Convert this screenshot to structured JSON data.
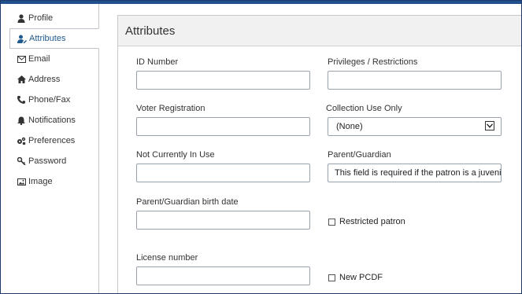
{
  "sidebar": {
    "items": [
      {
        "label": "Profile",
        "icon": "user-icon"
      },
      {
        "label": "Attributes",
        "icon": "user-edit-icon"
      },
      {
        "label": "Email",
        "icon": "envelope-icon"
      },
      {
        "label": "Address",
        "icon": "home-icon"
      },
      {
        "label": "Phone/Fax",
        "icon": "phone-icon"
      },
      {
        "label": "Notifications",
        "icon": "bell-icon"
      },
      {
        "label": "Preferences",
        "icon": "gears-icon"
      },
      {
        "label": "Password",
        "icon": "key-icon"
      },
      {
        "label": "Image",
        "icon": "image-icon"
      }
    ],
    "active": "Attributes"
  },
  "panel": {
    "title": "Attributes"
  },
  "fields": {
    "id_number": {
      "label": "ID Number",
      "value": ""
    },
    "privileges": {
      "label": "Privileges / Restrictions",
      "value": ""
    },
    "voter_registration": {
      "label": "Voter Registration",
      "value": ""
    },
    "collection_use": {
      "label": "Collection Use Only",
      "value": "(None)"
    },
    "not_in_use": {
      "label": "Not Currently In Use",
      "value": ""
    },
    "parent_guardian": {
      "label": "Parent/Guardian",
      "value": "This field is required if the patron is a juvenile"
    },
    "guardian_birth": {
      "label": "Parent/Guardian birth date",
      "value": ""
    },
    "restricted": {
      "label": "Restricted patron",
      "checked": false
    },
    "license": {
      "label": "License number",
      "value": ""
    },
    "new_pcdf": {
      "label": "New PCDF",
      "checked": false
    }
  },
  "colors": {
    "accent": "#1f5a8e",
    "topbar": "#20508e"
  }
}
